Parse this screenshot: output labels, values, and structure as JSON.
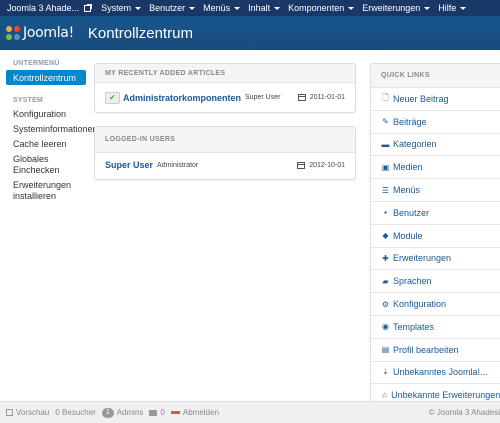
{
  "topbar": {
    "site_name": "Joomla 3 Ahade...",
    "menus": [
      "System",
      "Benutzer",
      "Menüs",
      "Inhalt",
      "Komponenten",
      "Erweiterungen",
      "Hilfe"
    ]
  },
  "header": {
    "logo_text": "Joomla!",
    "title": "Kontrollzentrum"
  },
  "sidebar": {
    "section1_title": "UNTERMENÜ",
    "active_item": "Kontrollzentrum",
    "section2_title": "SYSTEM",
    "items": [
      "Konfiguration",
      "Systeminformationen",
      "Cache leeren",
      "Globales Einchecken",
      "Erweiterungen installieren"
    ]
  },
  "recent_articles": {
    "title": "MY RECENTLY ADDED ARTICLES",
    "rows": [
      {
        "title": "Administratorkomponenten",
        "author": "Super User",
        "date": "2011-01-01"
      }
    ]
  },
  "logged_in": {
    "title": "LOGGED-IN USERS",
    "rows": [
      {
        "name": "Super User",
        "role": "Administrator",
        "date": "2012-10-01"
      }
    ]
  },
  "quick_links": {
    "title": "QUICK LINKS",
    "items": [
      {
        "icon": "new-article-icon",
        "glyph": "🗋",
        "label": "Neuer Beitrag"
      },
      {
        "icon": "pencil-icon",
        "glyph": "✎",
        "label": "Beiträge"
      },
      {
        "icon": "folder-icon",
        "glyph": "▬",
        "label": "Kategorien"
      },
      {
        "icon": "media-icon",
        "glyph": "▣",
        "label": "Medien"
      },
      {
        "icon": "list-icon",
        "glyph": "☰",
        "label": "Menüs"
      },
      {
        "icon": "user-icon",
        "glyph": "▪",
        "label": "Benutzer"
      },
      {
        "icon": "cube-icon",
        "glyph": "◆",
        "label": "Module"
      },
      {
        "icon": "puzzle-icon",
        "glyph": "✚",
        "label": "Erweiterungen"
      },
      {
        "icon": "comments-icon",
        "glyph": "▰",
        "label": "Sprachen"
      },
      {
        "icon": "cog-icon",
        "glyph": "⚙",
        "label": "Konfiguration"
      },
      {
        "icon": "eye-icon",
        "glyph": "◉",
        "label": "Templates"
      },
      {
        "icon": "profile-icon",
        "glyph": "▤",
        "label": "Profil bearbeiten"
      },
      {
        "icon": "download-icon",
        "glyph": "⤓",
        "label": "Unbekanntes Joomla!..."
      },
      {
        "icon": "star-icon",
        "glyph": "☆",
        "label": "Unbekannte Erweiterungen..."
      }
    ]
  },
  "statusbar": {
    "preview": "Vorschau",
    "visitors": "0 Besucher",
    "admins_count": "1",
    "admins": "Admins",
    "messages_count": "0",
    "logout": "Abmelden",
    "copyright": "© Joomla 3 Ahadesi"
  }
}
